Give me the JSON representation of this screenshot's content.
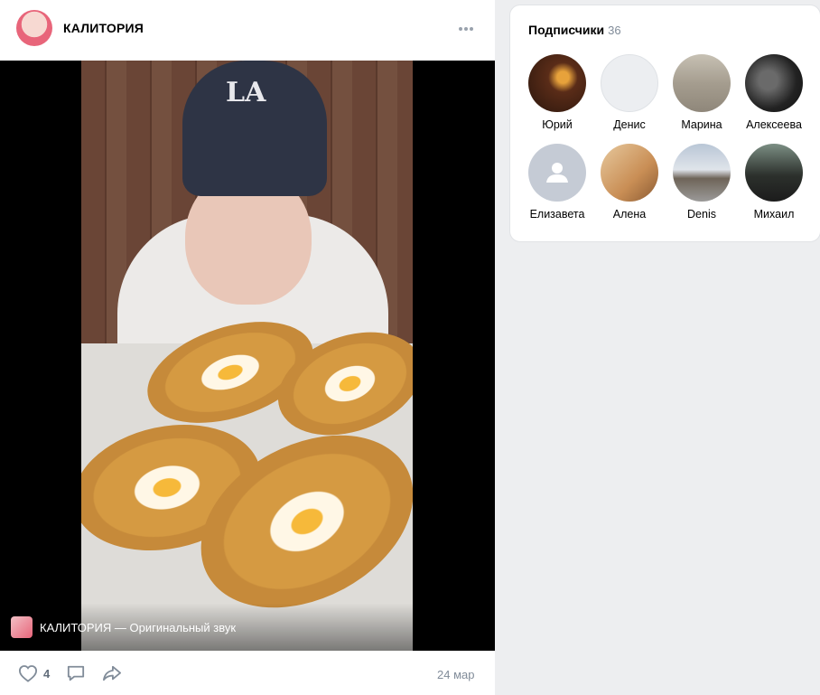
{
  "post": {
    "author": "КАЛИТОРИЯ",
    "caption": "КАЛИТОРИЯ — Оригинальный звук",
    "likes": "4",
    "date": "24 мар"
  },
  "subscribers": {
    "title": "Подписчики",
    "count": "36",
    "items": [
      {
        "name": "Юрий"
      },
      {
        "name": "Денис"
      },
      {
        "name": "Марина"
      },
      {
        "name": "Алексеева"
      },
      {
        "name": "Елизавета"
      },
      {
        "name": "Алена"
      },
      {
        "name": "Denis"
      },
      {
        "name": "Михаил"
      }
    ]
  },
  "icons": {
    "more": "more-horizontal-icon",
    "like": "heart-icon",
    "comment": "comment-icon",
    "share": "share-icon",
    "default_avatar": "user-silhouette-icon"
  },
  "colors": {
    "background": "#edeef0",
    "card": "#ffffff",
    "secondary_text": "#818c99"
  }
}
